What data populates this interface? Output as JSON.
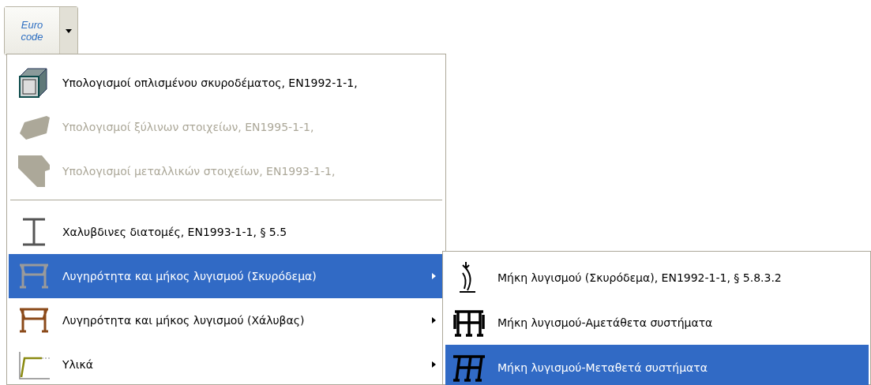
{
  "toolbar_button": {
    "label_lines": [
      "Euro",
      "code"
    ],
    "expanded": true
  },
  "menu": {
    "items": [
      {
        "kind": "item",
        "label": "Υπολογισμοί οπλισμένου σκυροδέματος,  EN1992-1-1,",
        "disabled": false,
        "selected": false,
        "submenu": false
      },
      {
        "kind": "item",
        "label": "Υπολογισμοί ξύλινων στοιχείων,  EN1995-1-1,",
        "disabled": true,
        "selected": false,
        "submenu": false
      },
      {
        "kind": "item",
        "label": "Υπολογισμοί μεταλλικών στοιχείων,  EN1993-1-1,",
        "disabled": true,
        "selected": false,
        "submenu": false
      },
      {
        "kind": "separator"
      },
      {
        "kind": "item",
        "label": "Χαλυβδινες διατομές,  EN1993-1-1, § 5.5",
        "disabled": false,
        "selected": false,
        "submenu": false
      },
      {
        "kind": "item",
        "label": "Λυγηρότητα και μήκος λυγισμού (Σκυρόδεμα)",
        "disabled": false,
        "selected": true,
        "submenu": true
      },
      {
        "kind": "item",
        "label": "Λυγηρότητα και μήκος λυγισμού (Χάλυβας)",
        "disabled": false,
        "selected": false,
        "submenu": true
      },
      {
        "kind": "item",
        "label": "Υλικά",
        "disabled": false,
        "selected": false,
        "submenu": true
      }
    ]
  },
  "submenu": {
    "items": [
      {
        "label": "Μήκη λυγισμού (Σκυρόδεμα),  EN1992-1-1, § 5.8.3.2",
        "selected": false
      },
      {
        "label": "Μήκη λυγισμού-Αμετάθετα συστήματα",
        "selected": false
      },
      {
        "label": "Μήκη λυγισμού-Μεταθετά συστήματα",
        "selected": true
      }
    ]
  }
}
